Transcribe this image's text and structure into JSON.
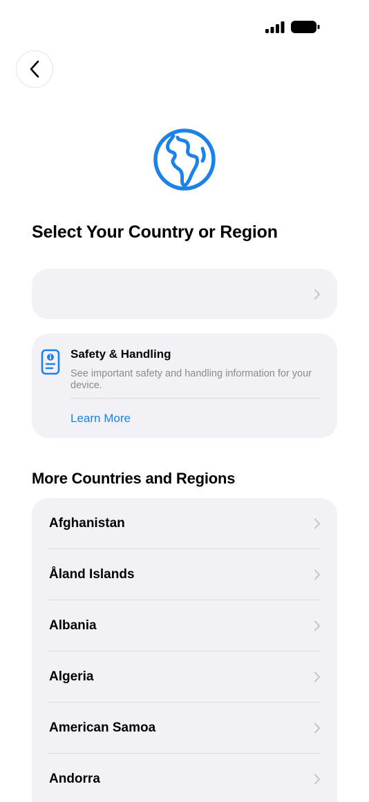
{
  "status_bar": {
    "signal_icon": "cellular-signal-icon",
    "battery_icon": "battery-icon"
  },
  "nav": {
    "back_icon": "chevron-left-icon"
  },
  "hero": {
    "icon": "globe-icon",
    "accent_color": "#1c82e8"
  },
  "title": "Select Your Country or Region",
  "selected_country": {
    "label": "",
    "chevron_icon": "chevron-right-icon"
  },
  "safety": {
    "icon": "document-info-icon",
    "title": "Safety & Handling",
    "description": "See important safety and handling information for your device.",
    "link_label": "Learn More"
  },
  "more_section": {
    "title": "More Countries and Regions",
    "countries": [
      "Afghanistan",
      "Åland Islands",
      "Albania",
      "Algeria",
      "American Samoa",
      "Andorra"
    ]
  }
}
